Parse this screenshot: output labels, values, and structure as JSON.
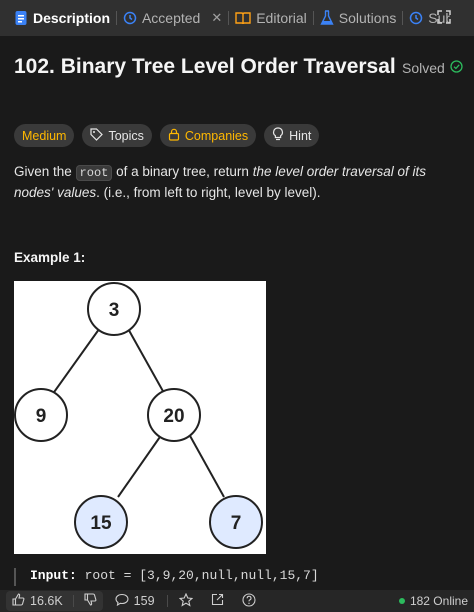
{
  "tabs": [
    {
      "label": "Description",
      "icon": "document-icon",
      "active": true
    },
    {
      "label": "Accepted",
      "icon": "history-icon",
      "closable": true
    },
    {
      "label": "Editorial",
      "icon": "book-icon"
    },
    {
      "label": "Solutions",
      "icon": "flask-icon"
    },
    {
      "label": "Submi",
      "icon": "history-icon"
    }
  ],
  "problem": {
    "title": "102. Binary Tree Level Order Traversal",
    "status": "Solved"
  },
  "tags": {
    "difficulty": "Medium",
    "topics": "Topics",
    "companies": "Companies",
    "hint": "Hint"
  },
  "description": {
    "part1": "Given the ",
    "code": "root",
    "part2": " of a binary tree, return ",
    "em": "the level order traversal of its nodes' values",
    "part3": ". (i.e., from left to right, level by level)."
  },
  "example": {
    "heading": "Example 1:",
    "tree_nodes": [
      "3",
      "9",
      "20",
      "15",
      "7"
    ],
    "input_label": "Input:",
    "input_value": "root = [3,9,20,null,null,15,7]"
  },
  "bottom_bar": {
    "likes": "16.6K",
    "comments": "159",
    "online": "182 Online"
  },
  "colors": {
    "accent_medium": "#ffb800",
    "solved_green": "#2cbb5d",
    "highlight_node": "#dfeaff"
  }
}
